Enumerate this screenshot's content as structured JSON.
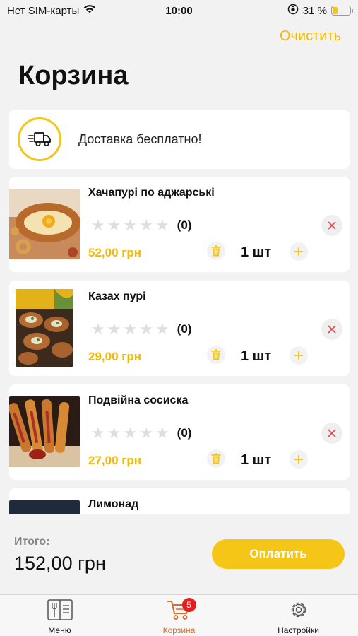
{
  "status_bar": {
    "carrier": "Нет SIM-карты",
    "time": "10:00",
    "battery_percent": "31 %",
    "battery_level": 0.31
  },
  "header": {
    "clear_label": "Очистить",
    "title": "Корзина"
  },
  "delivery": {
    "text": "Доставка бесплатно!",
    "icon": "delivery-truck-icon"
  },
  "items": [
    {
      "name": "Хачапурі по аджарські",
      "rating_count": "(0)",
      "rating": 0,
      "price": "52,00 грн",
      "qty": "1 шт"
    },
    {
      "name": "Казах пурі",
      "rating_count": "(0)",
      "rating": 0,
      "price": "29,00 грн",
      "qty": "1 шт"
    },
    {
      "name": "Подвійна сосиска",
      "rating_count": "(0)",
      "rating": 0,
      "price": "27,00 грн",
      "qty": "1 шт"
    },
    {
      "name": "Лимонад"
    }
  ],
  "summary": {
    "total_label": "Итого:",
    "total_value": "152,00 грн",
    "pay_label": "Оплатить"
  },
  "tabs": [
    {
      "label": "Меню",
      "icon": "menu-book-icon"
    },
    {
      "label": "Корзина",
      "icon": "cart-icon",
      "badge": "5",
      "active": true
    },
    {
      "label": "Настройки",
      "icon": "gear-icon"
    }
  ],
  "colors": {
    "accent": "#f5c518",
    "accent_text": "#f5b800",
    "active_tab": "#d96c2a",
    "badge": "#e02020",
    "remove_icon": "#e05050"
  }
}
